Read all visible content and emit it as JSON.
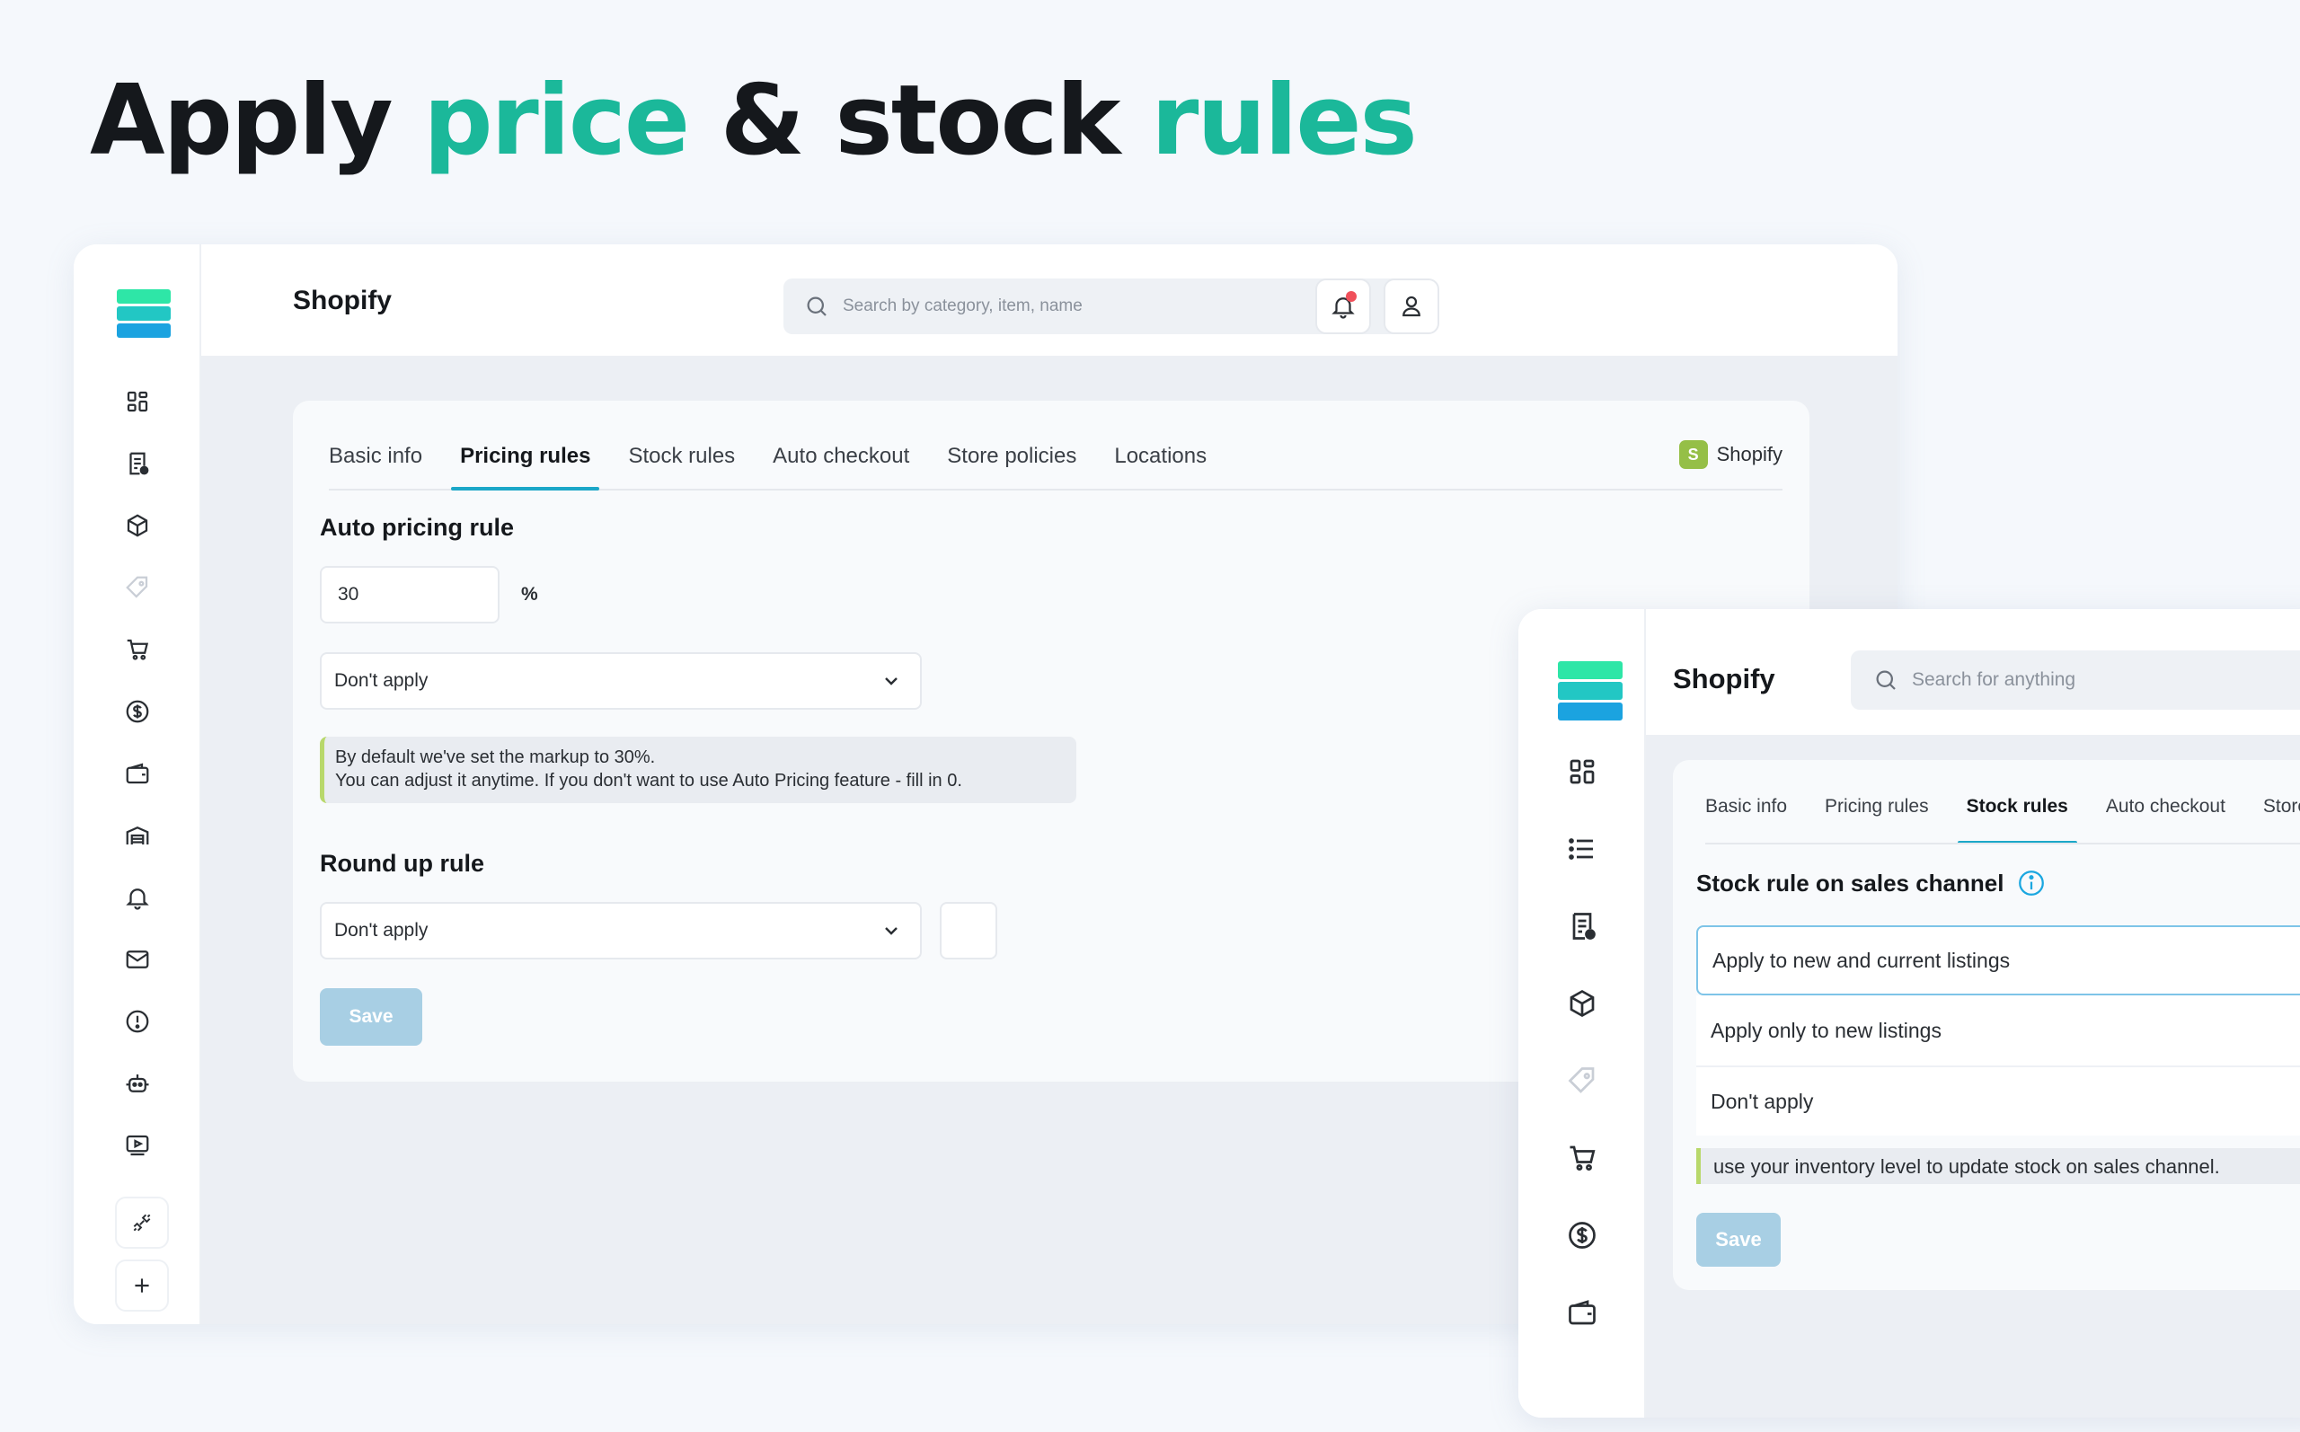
{
  "headline": {
    "word1": "Apply",
    "word2": "price",
    "word3": "&",
    "word4": "stock",
    "word5": "rules",
    "accent_color": "#1bb89a"
  },
  "window_pricing": {
    "app_name": "Shopify",
    "search_placeholder": "Search by category, item, name",
    "sidebar_icons": [
      "dashboard-icon",
      "orders-icon",
      "products-icon",
      "tag-icon",
      "cart-icon",
      "dollar-icon",
      "wallet-icon",
      "warehouse-icon",
      "bell-icon",
      "mail-icon",
      "alert-icon",
      "robot-icon",
      "video-icon",
      "plug-icon",
      "plus-icon"
    ],
    "tabs": [
      "Basic info",
      "Pricing rules",
      "Stock rules",
      "Auto checkout",
      "Store policies",
      "Locations"
    ],
    "active_tab": "Pricing rules",
    "channel_badge": "Shopify",
    "auto_pricing_title": "Auto pricing rule",
    "markup_value": "30",
    "markup_unit": "%",
    "auto_pricing_select": "Don't apply",
    "note_line1": "By default we've set the markup to 30%.",
    "note_line2": "You can adjust it anytime. If you don't want to use Auto Pricing feature - fill in 0.",
    "round_up_title": "Round up rule",
    "round_up_select": "Don't apply",
    "save_label": "Save"
  },
  "window_stock": {
    "app_name": "Shopify",
    "search_placeholder": "Search for anything",
    "sidebar_icons": [
      "dashboard-icon",
      "list-icon",
      "orders-icon",
      "products-icon",
      "tag-icon",
      "cart-icon",
      "dollar-icon",
      "wallet-icon"
    ],
    "tabs": [
      "Basic info",
      "Pricing rules",
      "Stock rules",
      "Auto checkout",
      "Store"
    ],
    "active_tab": "Stock rules",
    "section_title": "Stock rule on sales channel",
    "options": [
      "Apply to new and current listings",
      "Apply only to new listings",
      "Don't apply"
    ],
    "selected_option": "Apply to new and current listings",
    "note": "use your inventory level to update stock on sales channel.",
    "save_label": "Save"
  },
  "colors": {
    "brand_green": "#2ee6a7",
    "brand_teal": "#22c7c4",
    "brand_blue": "#1ba3e0",
    "tab_underline": "#1ba7c8",
    "save_disabled": "#a8cfe4",
    "note_border": "#b8d86b",
    "notification_dot": "#f0505a"
  }
}
